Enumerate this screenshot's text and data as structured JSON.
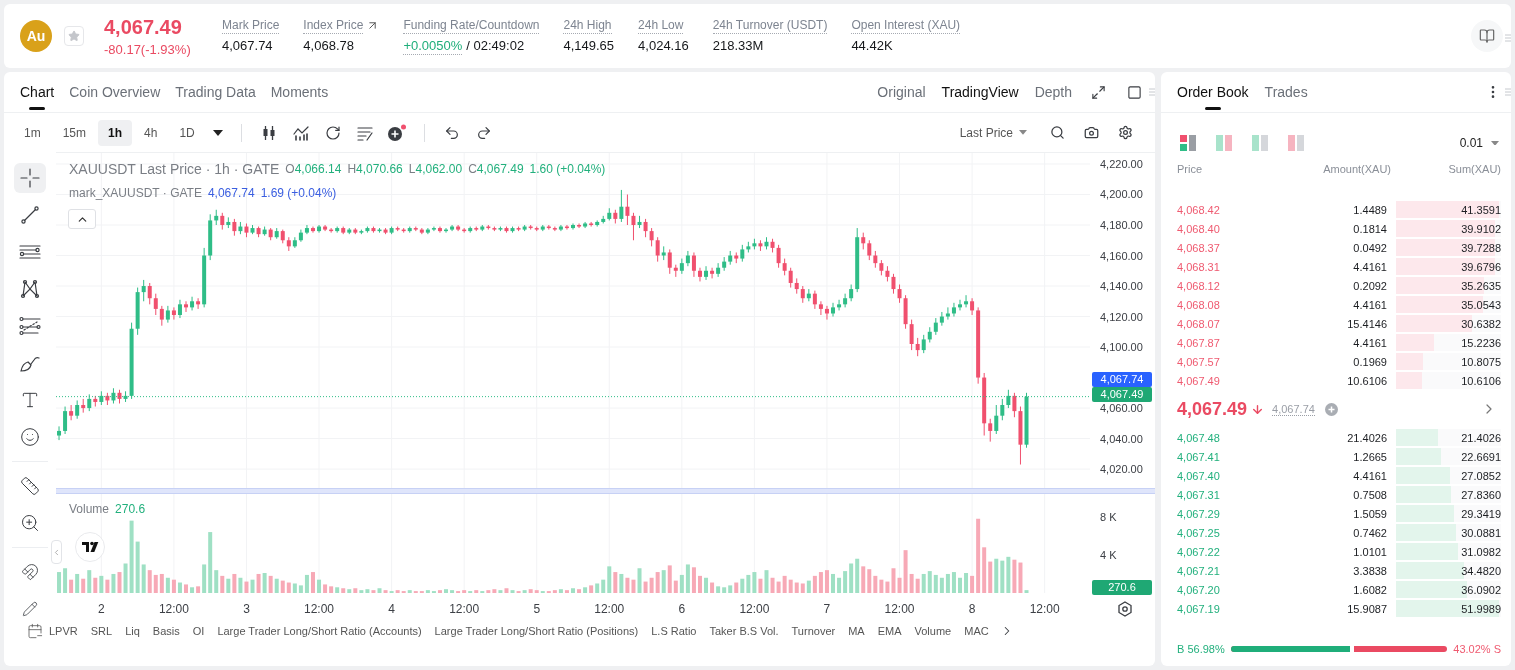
{
  "header": {
    "coin": "Au",
    "favorited": false,
    "price": "4,067.49",
    "change": "-80.17(-1.93%)",
    "stats": [
      {
        "kind": "plain",
        "label": "Mark Price",
        "value": "4,067.74"
      },
      {
        "kind": "link",
        "label": "Index Price",
        "value": "4,068.78"
      },
      {
        "kind": "funding",
        "label": "Funding Rate/Countdown",
        "value": "+0.0050%",
        "countdown": "/ 02:49:02"
      },
      {
        "kind": "plain",
        "label": "24h High",
        "value": "4,149.65"
      },
      {
        "kind": "plain",
        "label": "24h Low",
        "value": "4,024.16"
      },
      {
        "kind": "plain",
        "label": "24h Turnover (USDT)",
        "value": "218.33M"
      },
      {
        "kind": "plain",
        "label": "Open Interest (XAU)",
        "value": "44.42K"
      }
    ]
  },
  "chart_panel": {
    "tabs": [
      {
        "label": "Chart",
        "selected": true
      },
      {
        "label": "Coin Overview",
        "selected": false
      },
      {
        "label": "Trading Data",
        "selected": false
      },
      {
        "label": "Moments",
        "selected": false
      }
    ],
    "views": [
      {
        "label": "Original",
        "selected": false
      },
      {
        "label": "TradingView",
        "selected": true
      },
      {
        "label": "Depth",
        "selected": false
      }
    ],
    "intervals": [
      {
        "label": "1m",
        "selected": false
      },
      {
        "label": "15m",
        "selected": false
      },
      {
        "label": "1h",
        "selected": true
      },
      {
        "label": "4h",
        "selected": false
      },
      {
        "label": "1D",
        "selected": false
      }
    ],
    "price_source": "Last Price",
    "price_pane": {
      "legend": {
        "title": "XAUUSDT Last Price · 1h · GATE",
        "ohlc": [
          {
            "key": "O",
            "value": "4,066.14"
          },
          {
            "key": "H",
            "value": "4,070.66"
          },
          {
            "key": "L",
            "value": "4,062.00"
          },
          {
            "key": "C",
            "value": "4,067.49"
          }
        ],
        "change": "1.60 (+0.04%)"
      },
      "mark_legend": {
        "title": "mark_XAUUSDT · GATE",
        "value": "4,067.74",
        "change": "1.69 (+0.04%)"
      },
      "mark_price_tag": "4,067.74",
      "chart_data": {
        "type": "candlestick",
        "grid": true,
        "ylim": [
          4007.6,
          4227.2
        ],
        "yticks": [
          {
            "value": 4220,
            "label": "4,220.00"
          },
          {
            "value": 4200,
            "label": "4,200.00"
          },
          {
            "value": 4180,
            "label": "4,180.00"
          },
          {
            "value": 4160,
            "label": "4,160.00"
          },
          {
            "value": 4140,
            "label": "4,140.00"
          },
          {
            "value": 4120,
            "label": "4,120.00"
          },
          {
            "value": 4100,
            "label": "4,100.00"
          },
          {
            "value": 4060,
            "label": "4,060.00"
          },
          {
            "value": 4040,
            "label": "4,040.00"
          },
          {
            "value": 4020,
            "label": "4,020.00"
          }
        ],
        "categories": [
          null,
          null,
          null,
          null,
          null,
          null,
          null,
          null,
          null,
          null,
          null,
          null,
          null,
          null,
          null,
          null,
          null,
          null,
          null,
          null,
          null,
          null,
          null,
          null,
          null,
          null,
          null,
          null,
          null,
          null,
          null,
          null,
          null,
          null,
          null,
          null,
          null,
          null,
          null,
          null,
          null,
          null,
          null,
          null,
          null,
          null,
          null,
          null,
          null,
          null,
          null,
          null,
          null,
          null,
          null,
          null,
          null,
          null,
          null,
          null,
          null,
          null,
          null,
          null,
          null,
          null,
          null,
          null,
          null,
          null,
          null,
          null,
          null,
          null,
          null,
          null,
          null,
          null,
          null,
          null,
          null,
          null,
          null,
          null,
          null,
          null,
          null,
          null,
          null,
          null,
          null,
          null,
          null,
          null,
          null,
          null,
          null,
          null,
          null,
          null,
          null,
          null,
          null,
          null,
          null,
          null,
          null,
          null,
          null,
          null,
          null,
          null,
          null,
          null,
          null,
          null,
          null,
          null,
          null,
          null,
          null,
          null,
          null,
          null,
          null,
          null,
          null,
          null,
          null,
          null,
          null,
          null,
          null,
          null,
          null,
          null,
          null,
          null,
          null,
          null,
          null,
          null,
          null,
          null,
          null,
          null,
          null,
          null,
          null,
          null,
          null,
          null,
          null,
          null,
          null,
          null,
          null,
          null,
          null,
          null,
          null,
          null,
          null,
          null,
          null,
          null,
          null,
          null,
          null,
          null,
          null
        ],
        "ohlc": [
          [
            4042,
            4048,
            4039,
            4045
          ],
          [
            4045,
            4061,
            4043,
            4058
          ],
          [
            4058,
            4062,
            4052,
            4055
          ],
          [
            4055,
            4065,
            4053,
            4062
          ],
          [
            4062,
            4066,
            4057,
            4060
          ],
          [
            4060,
            4069,
            4058,
            4066
          ],
          [
            4066,
            4068,
            4061,
            4064
          ],
          [
            4064,
            4071,
            4062,
            4068
          ],
          [
            4068,
            4070,
            4062,
            4065
          ],
          [
            4065,
            4073,
            4063,
            4070
          ],
          [
            4070,
            4072,
            4063,
            4066
          ],
          [
            4066,
            4071,
            4064,
            4068
          ],
          [
            4068,
            4116,
            4066,
            4112
          ],
          [
            4112,
            4139,
            4108,
            4136
          ],
          [
            4136,
            4144,
            4130,
            4140
          ],
          [
            4140,
            4142,
            4128,
            4132
          ],
          [
            4132,
            4135,
            4121,
            4125
          ],
          [
            4125,
            4127,
            4114,
            4118
          ],
          [
            4118,
            4127,
            4116,
            4124
          ],
          [
            4124,
            4126,
            4118,
            4121
          ],
          [
            4121,
            4131,
            4119,
            4128
          ],
          [
            4128,
            4130,
            4123,
            4126
          ],
          [
            4126,
            4133,
            4124,
            4130
          ],
          [
            4130,
            4132,
            4125,
            4128
          ],
          [
            4128,
            4165,
            4126,
            4160
          ],
          [
            4160,
            4187,
            4157,
            4183
          ],
          [
            4183,
            4190,
            4180,
            4186
          ],
          [
            4186,
            4188,
            4177,
            4180
          ],
          [
            4180,
            4185,
            4178,
            4182
          ],
          [
            4182,
            4184,
            4173,
            4176
          ],
          [
            4176,
            4182,
            4174,
            4179
          ],
          [
            4179,
            4181,
            4172,
            4175
          ],
          [
            4175,
            4180,
            4174,
            4178
          ],
          [
            4178,
            4179,
            4172,
            4174
          ],
          [
            4174,
            4179,
            4173,
            4177
          ],
          [
            4177,
            4178,
            4170,
            4172
          ],
          [
            4172,
            4178,
            4171,
            4176
          ],
          [
            4176,
            4177,
            4168,
            4170
          ],
          [
            4170,
            4172,
            4163,
            4166
          ],
          [
            4166,
            4172,
            4165,
            4170
          ],
          [
            4170,
            4177,
            4169,
            4175
          ],
          [
            4175,
            4180,
            4174,
            4178
          ],
          [
            4178,
            4179,
            4175,
            4176
          ],
          [
            4176,
            4180,
            4175,
            4179
          ],
          [
            4179,
            4180,
            4176,
            4177
          ],
          [
            4177,
            4178,
            4175,
            4176
          ],
          [
            4176,
            4179,
            4175,
            4178
          ],
          [
            4178,
            4179,
            4174,
            4175
          ],
          [
            4175,
            4178,
            4174,
            4177
          ],
          [
            4177,
            4178,
            4174,
            4175
          ],
          [
            4175,
            4177,
            4174,
            4176
          ],
          [
            4176,
            4179,
            4175,
            4178
          ],
          [
            4178,
            4179,
            4175,
            4176
          ],
          [
            4176,
            4178,
            4175,
            4177
          ],
          [
            4177,
            4178,
            4174,
            4175
          ],
          [
            4175,
            4179,
            4174,
            4178
          ],
          [
            4178,
            4179,
            4176,
            4177
          ],
          [
            4177,
            4178,
            4175,
            4176
          ],
          [
            4176,
            4179,
            4175,
            4178
          ],
          [
            4178,
            4179,
            4176,
            4177
          ],
          [
            4177,
            4178,
            4174,
            4175
          ],
          [
            4175,
            4178,
            4174,
            4177
          ],
          [
            4177,
            4179,
            4176,
            4178
          ],
          [
            4178,
            4179,
            4175,
            4176
          ],
          [
            4176,
            4178,
            4175,
            4177
          ],
          [
            4177,
            4180,
            4176,
            4179
          ],
          [
            4179,
            4180,
            4176,
            4177
          ],
          [
            4177,
            4178,
            4175,
            4176
          ],
          [
            4176,
            4179,
            4175,
            4178
          ],
          [
            4178,
            4179,
            4176,
            4177
          ],
          [
            4177,
            4180,
            4176,
            4179
          ],
          [
            4179,
            4180,
            4177,
            4178
          ],
          [
            4178,
            4179,
            4176,
            4177
          ],
          [
            4177,
            4179,
            4176,
            4178
          ],
          [
            4178,
            4179,
            4175,
            4176
          ],
          [
            4176,
            4179,
            4175,
            4178
          ],
          [
            4178,
            4179,
            4176,
            4177
          ],
          [
            4177,
            4180,
            4176,
            4179
          ],
          [
            4179,
            4180,
            4177,
            4178
          ],
          [
            4178,
            4179,
            4176,
            4177
          ],
          [
            4177,
            4180,
            4176,
            4179
          ],
          [
            4179,
            4180,
            4177,
            4178
          ],
          [
            4178,
            4179,
            4176,
            4177
          ],
          [
            4177,
            4180,
            4176,
            4179
          ],
          [
            4179,
            4180,
            4177,
            4178
          ],
          [
            4178,
            4181,
            4177,
            4180
          ],
          [
            4180,
            4181,
            4178,
            4179
          ],
          [
            4179,
            4182,
            4178,
            4181
          ],
          [
            4181,
            4182,
            4179,
            4180
          ],
          [
            4180,
            4183,
            4179,
            4182
          ],
          [
            4182,
            4186,
            4181,
            4184
          ],
          [
            4184,
            4191,
            4183,
            4188
          ],
          [
            4188,
            4190,
            4181,
            4184
          ],
          [
            4184,
            4203,
            4182,
            4192
          ],
          [
            4192,
            4200,
            4180,
            4186
          ],
          [
            4186,
            4188,
            4170,
            4180
          ],
          [
            4180,
            4186,
            4178,
            4182
          ],
          [
            4182,
            4184,
            4172,
            4176
          ],
          [
            4176,
            4178,
            4166,
            4170
          ],
          [
            4170,
            4172,
            4156,
            4160
          ],
          [
            4160,
            4166,
            4157,
            4162
          ],
          [
            4162,
            4164,
            4148,
            4152
          ],
          [
            4152,
            4154,
            4146,
            4150
          ],
          [
            4150,
            4158,
            4148,
            4155
          ],
          [
            4155,
            4163,
            4153,
            4160
          ],
          [
            4160,
            4162,
            4146,
            4150
          ],
          [
            4150,
            4152,
            4143,
            4146
          ],
          [
            4146,
            4153,
            4144,
            4150
          ],
          [
            4150,
            4152,
            4145,
            4148
          ],
          [
            4148,
            4155,
            4146,
            4152
          ],
          [
            4152,
            4159,
            4150,
            4156
          ],
          [
            4156,
            4163,
            4154,
            4160
          ],
          [
            4160,
            4162,
            4155,
            4158
          ],
          [
            4158,
            4167,
            4156,
            4164
          ],
          [
            4164,
            4169,
            4162,
            4166
          ],
          [
            4166,
            4171,
            4164,
            4168
          ],
          [
            4168,
            4170,
            4163,
            4166
          ],
          [
            4166,
            4172,
            4164,
            4169
          ],
          [
            4169,
            4171,
            4162,
            4165
          ],
          [
            4165,
            4167,
            4152,
            4155
          ],
          [
            4155,
            4158,
            4147,
            4150
          ],
          [
            4150,
            4152,
            4139,
            4142
          ],
          [
            4142,
            4145,
            4135,
            4138
          ],
          [
            4138,
            4140,
            4129,
            4132
          ],
          [
            4132,
            4138,
            4130,
            4135
          ],
          [
            4135,
            4137,
            4125,
            4128
          ],
          [
            4128,
            4130,
            4121,
            4125
          ],
          [
            4125,
            4127,
            4118,
            4122
          ],
          [
            4122,
            4129,
            4120,
            4126
          ],
          [
            4126,
            4131,
            4124,
            4128
          ],
          [
            4128,
            4135,
            4126,
            4132
          ],
          [
            4132,
            4141,
            4130,
            4138
          ],
          [
            4138,
            4178,
            4136,
            4172
          ],
          [
            4172,
            4175,
            4164,
            4168
          ],
          [
            4168,
            4170,
            4157,
            4160
          ],
          [
            4160,
            4163,
            4152,
            4155
          ],
          [
            4155,
            4157,
            4147,
            4150
          ],
          [
            4150,
            4153,
            4143,
            4146
          ],
          [
            4146,
            4148,
            4135,
            4138
          ],
          [
            4138,
            4141,
            4129,
            4132
          ],
          [
            4132,
            4134,
            4112,
            4115
          ],
          [
            4115,
            4118,
            4098,
            4102
          ],
          [
            4102,
            4106,
            4094,
            4098
          ],
          [
            4098,
            4108,
            4096,
            4105
          ],
          [
            4105,
            4113,
            4103,
            4110
          ],
          [
            4110,
            4119,
            4108,
            4116
          ],
          [
            4116,
            4123,
            4114,
            4120
          ],
          [
            4120,
            4126,
            4118,
            4122
          ],
          [
            4122,
            4129,
            4120,
            4126
          ],
          [
            4126,
            4131,
            4124,
            4128
          ],
          [
            4128,
            4134,
            4126,
            4130
          ],
          [
            4130,
            4132,
            4121,
            4124
          ],
          [
            4124,
            4126,
            4076,
            4080
          ],
          [
            4080,
            4083,
            4042,
            4050
          ],
          [
            4050,
            4053,
            4038,
            4045
          ],
          [
            4045,
            4062,
            4043,
            4055
          ],
          [
            4055,
            4066,
            4052,
            4062
          ],
          [
            4062,
            4072,
            4060,
            4068
          ],
          [
            4068,
            4070,
            4054,
            4058
          ],
          [
            4058,
            4061,
            4023,
            4036
          ],
          [
            4036,
            4070,
            4034,
            4067.5
          ],
          null,
          null,
          null,
          null,
          null,
          null,
          null,
          null,
          null,
          null
        ],
        "ref_lines": [
          {
            "axis": "y",
            "value": 4067.49,
            "label": "4,067.49",
            "color": "#2fbd87"
          }
        ]
      }
    },
    "volume_pane": {
      "tag": "270.6",
      "value": "270.6",
      "chart_data": {
        "type": "bar",
        "grid": true,
        "ylim": [
          0,
          10.4
        ],
        "yticks": [
          {
            "value": 8,
            "label": "8 K"
          },
          {
            "value": 4,
            "label": "4 K"
          }
        ],
        "categories": [
          null,
          null,
          null,
          null,
          null,
          null,
          null,
          "2",
          null,
          null,
          null,
          null,
          null,
          null,
          null,
          null,
          null,
          null,
          null,
          "12:00",
          null,
          null,
          null,
          null,
          null,
          null,
          null,
          null,
          null,
          null,
          null,
          "3",
          null,
          null,
          null,
          null,
          null,
          null,
          null,
          null,
          null,
          null,
          null,
          "12:00",
          null,
          null,
          null,
          null,
          null,
          null,
          null,
          null,
          null,
          null,
          null,
          "4",
          null,
          null,
          null,
          null,
          null,
          null,
          null,
          null,
          null,
          null,
          null,
          "12:00",
          null,
          null,
          null,
          null,
          null,
          null,
          null,
          null,
          null,
          null,
          null,
          "5",
          null,
          null,
          null,
          null,
          null,
          null,
          null,
          null,
          null,
          null,
          null,
          "12:00",
          null,
          null,
          null,
          null,
          null,
          null,
          null,
          null,
          null,
          null,
          null,
          "6",
          null,
          null,
          null,
          null,
          null,
          null,
          null,
          null,
          null,
          null,
          null,
          "12:00",
          null,
          null,
          null,
          null,
          null,
          null,
          null,
          null,
          null,
          null,
          null,
          "7",
          null,
          null,
          null,
          null,
          null,
          null,
          null,
          null,
          null,
          null,
          null,
          "12:00",
          null,
          null,
          null,
          null,
          null,
          null,
          null,
          null,
          null,
          null,
          null,
          "8",
          null,
          null,
          null,
          null,
          null,
          null,
          null,
          null,
          null,
          null,
          null,
          "12:00",
          null,
          null,
          null,
          null,
          null,
          null,
          null
        ],
        "series": [
          {
            "name": "Volume",
            "values": [
              2.2,
              2.6,
              1.4,
              2.0,
              1.5,
              2.4,
              1.6,
              1.8,
              1.4,
              2.0,
              2.2,
              3.1,
              7.6,
              5.4,
              3.0,
              2.4,
              1.9,
              2.0,
              1.6,
              1.4,
              1.1,
              0.9,
              0.6,
              0.7,
              3.0,
              6.4,
              2.4,
              1.8,
              1.5,
              2.0,
              1.6,
              1.2,
              1.4,
              2.0,
              2.1,
              1.8,
              1.5,
              1.3,
              1.1,
              1.0,
              0.8,
              1.9,
              2.2,
              1.4,
              0.9,
              0.7,
              0.6,
              0.5,
              0.4,
              0.5,
              0.3,
              0.4,
              0.3,
              0.5,
              0.3,
              0.2,
              0.3,
              0.2,
              0.3,
              0.2,
              0.2,
              0.3,
              0.2,
              0.3,
              0.4,
              0.3,
              0.2,
              0.3,
              0.2,
              0.3,
              0.2,
              0.3,
              0.4,
              0.3,
              0.5,
              0.3,
              0.2,
              0.3,
              0.4,
              0.3,
              0.2,
              0.2,
              0.3,
              0.4,
              0.3,
              0.5,
              0.4,
              0.6,
              0.8,
              1.0,
              1.4,
              2.8,
              2.2,
              2.0,
              1.6,
              1.4,
              2.6,
              1.2,
              1.6,
              2.2,
              2.4,
              2.9,
              1.3,
              1.9,
              3.0,
              2.7,
              1.8,
              1.6,
              1.1,
              0.7,
              0.6,
              0.8,
              1.1,
              1.5,
              1.9,
              2.2,
              1.5,
              2.4,
              1.6,
              1.2,
              1.8,
              1.4,
              1.1,
              1.0,
              1.3,
              1.8,
              2.2,
              2.4,
              2.0,
              1.6,
              2.3,
              3.1,
              3.6,
              2.8,
              2.5,
              1.8,
              1.4,
              1.2,
              2.6,
              1.6,
              4.5,
              2.0,
              1.5,
              2.0,
              2.3,
              1.9,
              1.6,
              2.0,
              2.2,
              1.6,
              2.1,
              1.8,
              7.8,
              4.8,
              3.3,
              3.6,
              3.4,
              3.8,
              3.5,
              3.2,
              0.3,
              null,
              null,
              null,
              null,
              null,
              null,
              null,
              null,
              null,
              null
            ]
          }
        ]
      }
    },
    "indicators": [
      "LPVR",
      "SRL",
      "Liq",
      "Basis",
      "OI",
      "Large Trader Long/Short Ratio (Accounts)",
      "Large Trader Long/Short Ratio (Positions)",
      "L.S Ratio",
      "Taker B.S Vol.",
      "Turnover",
      "MA",
      "EMA",
      "Volume",
      "MAC"
    ]
  },
  "order_book": {
    "tabs": [
      {
        "label": "Order Book",
        "selected": true
      },
      {
        "label": "Trades",
        "selected": false
      }
    ],
    "layouts": [
      {
        "kind": "stacked",
        "selected": true
      },
      {
        "kind": "split",
        "selected": false
      },
      {
        "kind": "bids",
        "selected": false
      },
      {
        "kind": "asks",
        "selected": false
      }
    ],
    "precision": "0.01",
    "columns": [
      "Price",
      "Amount(XAU)",
      "Sum(XAU)"
    ],
    "asks": [
      {
        "price": "4,068.42",
        "amount": "1.4489",
        "sum": "41.3591",
        "level": 1
      },
      {
        "price": "4,068.40",
        "amount": "0.1814",
        "sum": "39.9102",
        "level": 0.965
      },
      {
        "price": "4,068.37",
        "amount": "0.0492",
        "sum": "39.7288",
        "level": 0.961
      },
      {
        "price": "4,068.31",
        "amount": "4.4161",
        "sum": "39.6796",
        "level": 0.959
      },
      {
        "price": "4,068.12",
        "amount": "0.2092",
        "sum": "35.2635",
        "level": 0.853
      },
      {
        "price": "4,068.08",
        "amount": "4.4161",
        "sum": "35.0543",
        "level": 0.848
      },
      {
        "price": "4,068.07",
        "amount": "15.4146",
        "sum": "30.6382",
        "level": 0.741
      },
      {
        "price": "4,067.87",
        "amount": "4.4161",
        "sum": "15.2236",
        "level": 0.368
      },
      {
        "price": "4,067.57",
        "amount": "0.1969",
        "sum": "10.8075",
        "level": 0.261
      },
      {
        "price": "4,067.49",
        "amount": "10.6106",
        "sum": "10.6106",
        "level": 0.257
      }
    ],
    "mid": {
      "price": "4,067.49",
      "mark": "4,067.74"
    },
    "bids": [
      {
        "price": "4,067.48",
        "amount": "21.4026",
        "sum": "21.4026",
        "level": 0.412
      },
      {
        "price": "4,067.41",
        "amount": "1.2665",
        "sum": "22.6691",
        "level": 0.436
      },
      {
        "price": "4,067.40",
        "amount": "4.4161",
        "sum": "27.0852",
        "level": 0.521
      },
      {
        "price": "4,067.31",
        "amount": "0.7508",
        "sum": "27.8360",
        "level": 0.535
      },
      {
        "price": "4,067.29",
        "amount": "1.5059",
        "sum": "29.3419",
        "level": 0.564
      },
      {
        "price": "4,067.25",
        "amount": "0.7462",
        "sum": "30.0881",
        "level": 0.579
      },
      {
        "price": "4,067.22",
        "amount": "1.0101",
        "sum": "31.0982",
        "level": 0.598
      },
      {
        "price": "4,067.21",
        "amount": "3.3838",
        "sum": "34.4820",
        "level": 0.663
      },
      {
        "price": "4,067.20",
        "amount": "1.6082",
        "sum": "36.0902",
        "level": 0.694
      },
      {
        "price": "4,067.19",
        "amount": "15.9087",
        "sum": "51.9989",
        "level": 1
      }
    ],
    "ratio": {
      "buy": "B 56.98%",
      "sell": "43.02% S",
      "level": 0.5698
    }
  }
}
